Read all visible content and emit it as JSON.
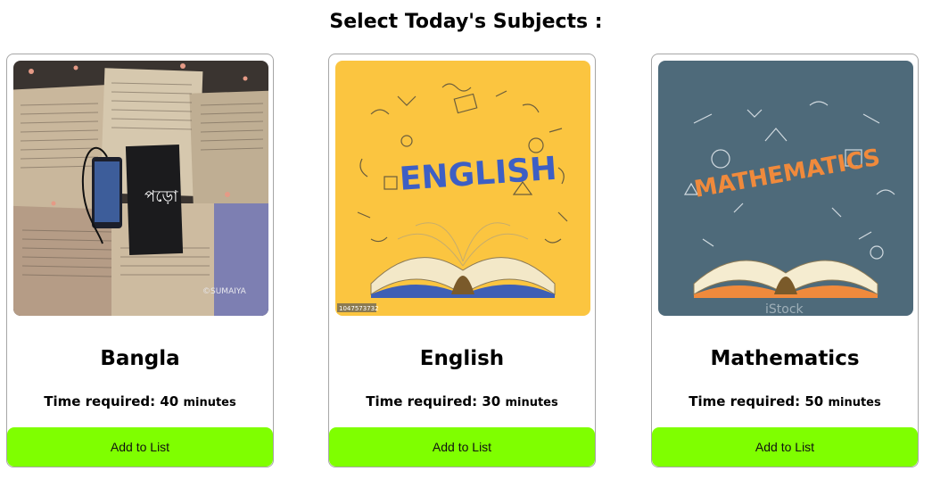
{
  "header": {
    "title": "Select Today's Subjects :"
  },
  "cards": [
    {
      "subject": "Bangla",
      "time_label": "Time required:",
      "time_value": "40",
      "time_unit": "minutes",
      "button_label": "Add to List",
      "image": {
        "book_title": "পড়ো",
        "watermark": "©SUMAIYA"
      }
    },
    {
      "subject": "English",
      "time_label": "Time required:",
      "time_value": "30",
      "time_unit": "minutes",
      "button_label": "Add to List",
      "image": {
        "headline": "ENGLISH",
        "stock_id": "1047573732"
      }
    },
    {
      "subject": "Mathematics",
      "time_label": "Time required:",
      "time_value": "50",
      "time_unit": "minutes",
      "button_label": "Add to List",
      "image": {
        "headline": "MATHEMATICS",
        "watermark": "iStock"
      }
    }
  ],
  "colors": {
    "button_bg": "#7fff00",
    "card_border": "#a6a6a6",
    "english_bg": "#fbc540",
    "math_bg": "#4e6a7a"
  }
}
